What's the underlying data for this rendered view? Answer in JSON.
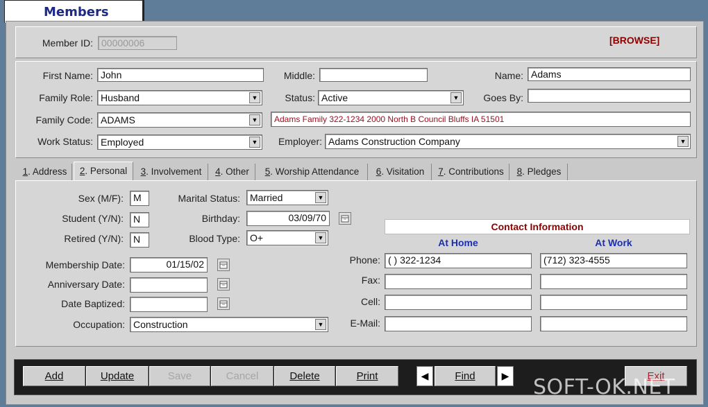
{
  "window": {
    "title": "Members"
  },
  "header": {
    "member_id_label": "Member ID:",
    "member_id_value": "00000006",
    "mode": "[BROWSE]"
  },
  "info": {
    "first_name_label": "First Name:",
    "first_name": "John",
    "middle_label": "Middle:",
    "middle": "",
    "name_label": "Name:",
    "name": "Adams",
    "family_role_label": "Family Role:",
    "family_role": "Husband",
    "status_label": "Status:",
    "status": "Active",
    "goes_by_label": "Goes By:",
    "goes_by": "",
    "family_code_label": "Family Code:",
    "family_code": "ADAMS",
    "family_address": "Adams Family 322-1234 2000 North B Council Bluffs IA 51501",
    "work_status_label": "Work Status:",
    "work_status": "Employed",
    "employer_label": "Employer:",
    "employer": "Adams Construction Company"
  },
  "tabs": [
    {
      "key": "1",
      "label": "Address"
    },
    {
      "key": "2",
      "label": "Personal"
    },
    {
      "key": "3",
      "label": "Involvement"
    },
    {
      "key": "4",
      "label": "Other"
    },
    {
      "key": "5",
      "label": "Worship Attendance"
    },
    {
      "key": "6",
      "label": "Visitation"
    },
    {
      "key": "7",
      "label": "Contributions"
    },
    {
      "key": "8",
      "label": "Pledges"
    }
  ],
  "personal": {
    "sex_label": "Sex (M/F):",
    "sex": "M",
    "student_label": "Student (Y/N):",
    "student": "N",
    "retired_label": "Retired (Y/N):",
    "retired": "N",
    "marital_label": "Marital Status:",
    "marital": "Married",
    "birthday_label": "Birthday:",
    "birthday": "03/09/70",
    "blood_label": "Blood Type:",
    "blood": "O+",
    "membership_label": "Membership Date:",
    "membership": "01/15/02",
    "anniversary_label": "Anniversary Date:",
    "anniversary": "",
    "baptized_label": "Date Baptized:",
    "baptized": "",
    "occupation_label": "Occupation:",
    "occupation": "Construction"
  },
  "contact": {
    "title": "Contact Information",
    "home_header": "At Home",
    "work_header": "At Work",
    "phone_label": "Phone:",
    "phone_home": "(  ) 322-1234",
    "phone_work": "(712) 323-4555",
    "fax_label": "Fax:",
    "cell_label": "Cell:",
    "email_label": "E-Mail:"
  },
  "toolbar": {
    "add": "Add",
    "update": "Update",
    "save": "Save",
    "cancel": "Cancel",
    "delete": "Delete",
    "print": "Print",
    "find": "Find",
    "exit": "Exit",
    "prev_arrow": "◀",
    "next_arrow": "▶"
  },
  "watermark": "SOFT-OK.NET",
  "colors": {
    "title": "#1c2a86",
    "mode": "#8b0000",
    "family_address": "#9a1020",
    "contact_header": "#1a2fb0"
  },
  "icons": [
    "calendar-icon",
    "dropdown-arrow-icon"
  ]
}
